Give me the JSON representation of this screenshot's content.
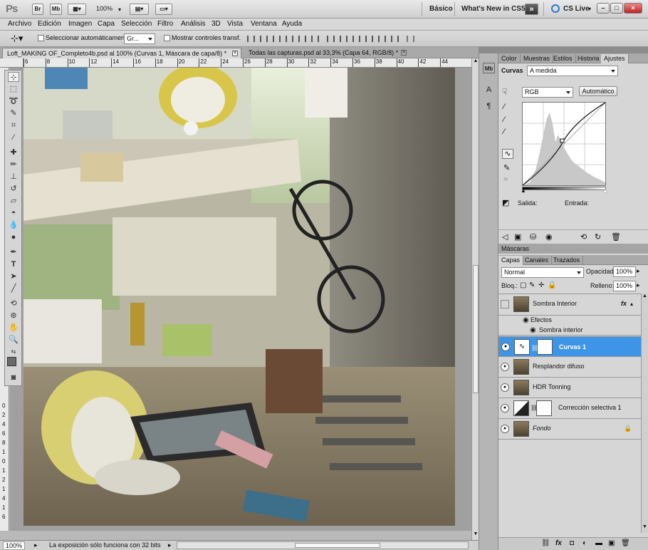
{
  "appbar": {
    "logo": "Ps",
    "buttons": [
      "Br",
      "Mb"
    ],
    "zoom": "100%",
    "workspace_basic": "Básico",
    "whats_new": "What's New in CS5",
    "cs_live": "CS Live",
    "window_controls": [
      "–",
      "□",
      "×"
    ]
  },
  "menu": [
    "Archivo",
    "Edición",
    "Imagen",
    "Capa",
    "Selección",
    "Filtro",
    "Análisis",
    "3D",
    "Vista",
    "Ventana",
    "Ayuda"
  ],
  "options": {
    "auto_select_label": "Seleccionar automáticamente:",
    "auto_select_value": "Gr...",
    "show_transform_label": "Mostrar controles transf."
  },
  "doc_tabs": [
    {
      "label": "Loft_MAKING OF_Completo4b.psd al 100% (Curvas 1, Máscara de capa/8) *",
      "active": true
    },
    {
      "label": "Todas las capturas.psd al 33,3% (Capa 64, RGB/8) *",
      "active": false
    }
  ],
  "ruler": {
    "h_ticks": [
      "6",
      "8",
      "10",
      "12",
      "14",
      "16",
      "18",
      "20",
      "22",
      "24",
      "26",
      "28",
      "30",
      "32",
      "34",
      "36",
      "38",
      "40",
      "42",
      "44"
    ],
    "v_ticks": [
      "0",
      "2",
      "4",
      "6",
      "8",
      "1",
      "0",
      "1",
      "2",
      "1",
      "4",
      "1",
      "6"
    ]
  },
  "status": {
    "zoom": "100%",
    "message": "La exposición sólo funciona con 32 bits"
  },
  "panel_top": {
    "tabs": [
      "Color",
      "Muestras",
      "Estilos",
      "Historia",
      "Ajustes"
    ],
    "active_tab": "Ajustes",
    "title": "Curvas",
    "preset": "A medida",
    "channel": "RGB",
    "auto_button": "Automático",
    "output_label": "Salida:",
    "input_label": "Entrada:"
  },
  "masks_panel": {
    "title": "Máscaras"
  },
  "layers_panel": {
    "tabs": [
      "Capas",
      "Canales",
      "Trazados"
    ],
    "blend_mode": "Normal",
    "opacity_label": "Opacidad:",
    "opacity_value": "100%",
    "lock_label": "Bloq.:",
    "fill_label": "Relleno:",
    "fill_value": "100%",
    "layers": [
      {
        "name": "Sombra Interior",
        "visible": false,
        "fx": "fx",
        "mask": false,
        "selected": false
      },
      {
        "name": "Efectos",
        "sub": true
      },
      {
        "name": "Sombra interior",
        "sub": true
      },
      {
        "name": "Curvas 1",
        "visible": true,
        "mask": true,
        "selected": true,
        "adjust": true
      },
      {
        "name": "Resplandor difuso",
        "visible": true,
        "mask": false,
        "selected": false
      },
      {
        "name": "HDR Tonning",
        "visible": true,
        "mask": false,
        "selected": false
      },
      {
        "name": "Corrección selectiva 1",
        "visible": true,
        "mask": true,
        "selected": false,
        "adjust": true
      },
      {
        "name": "Fondo",
        "visible": true,
        "mask": false,
        "selected": false,
        "italic": true,
        "locked": true
      }
    ]
  },
  "colors": {
    "selected_layer": "#3e95e7",
    "panel_bg": "#d6d6d6",
    "toolbar_bg": "#d5d5d5"
  }
}
